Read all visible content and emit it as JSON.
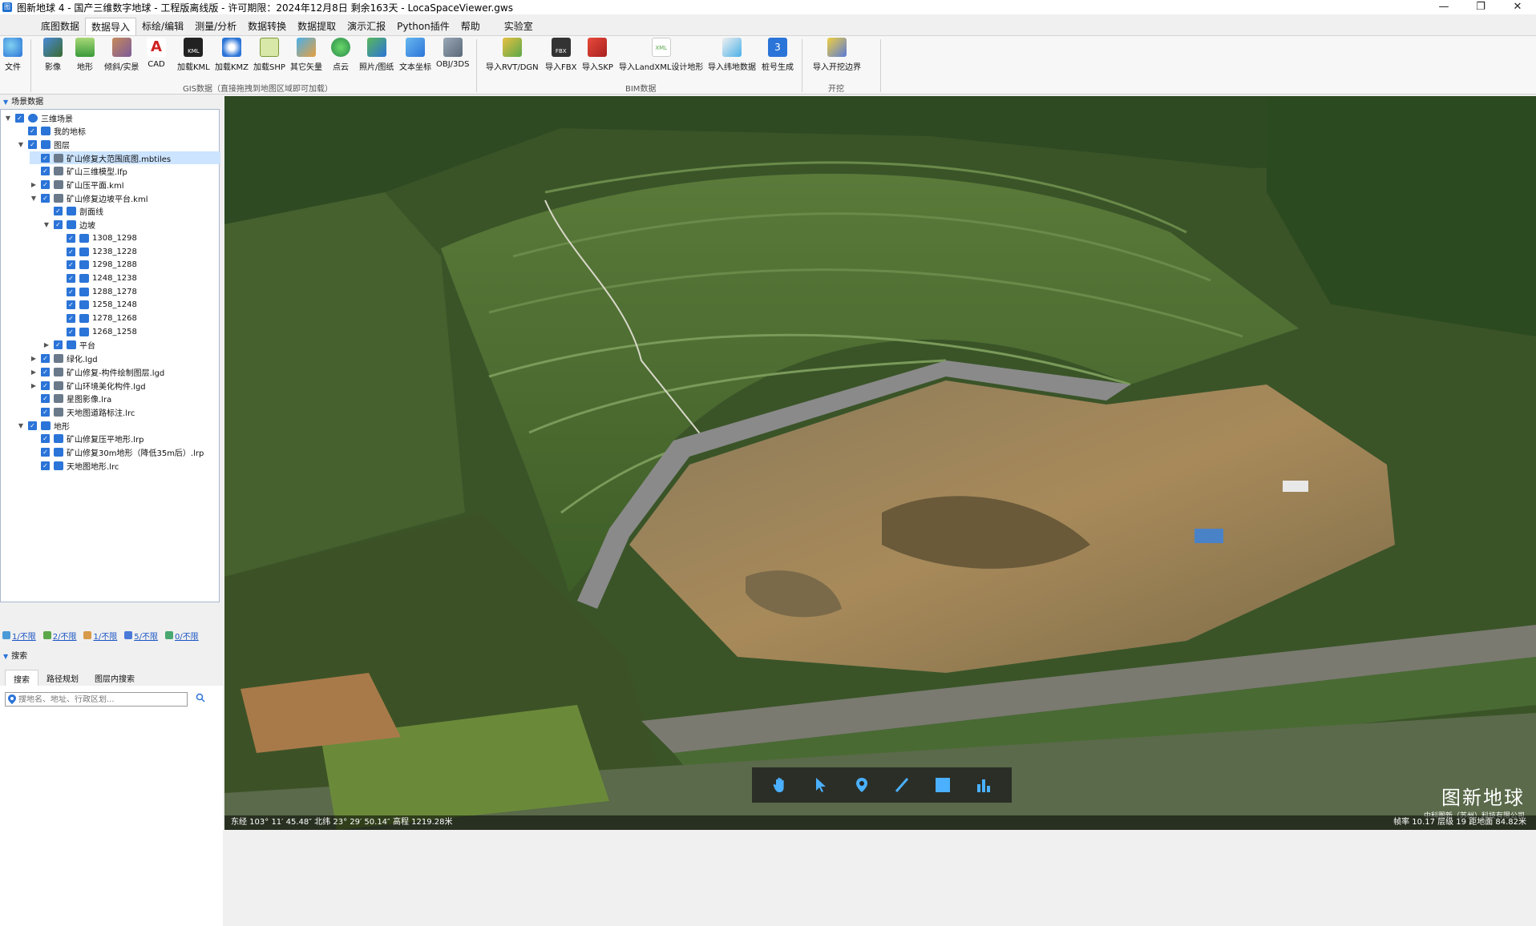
{
  "window": {
    "title": "图新地球 4 - 国产三维数字地球 - 工程版离线版 - 许可期限：2024年12月8日 剩余163天 - LocaSpaceViewer.gws",
    "minimize": "—",
    "maximize": "❐",
    "close": "✕"
  },
  "menu": [
    "底图数据",
    "数据导入",
    "标绘/编辑",
    "测量/分析",
    "数据转换",
    "数据提取",
    "演示汇报",
    "Python插件",
    "帮助",
    "实验室"
  ],
  "menu_active": "数据导入",
  "ribbon": {
    "file": "文件",
    "gis_buttons": [
      "影像",
      "地形",
      "倾斜/实景",
      "CAD",
      "加载KML",
      "加载KMZ",
      "加载SHP",
      "其它矢量",
      "点云",
      "照片/图纸",
      "文本坐标",
      "OBJ/3DS"
    ],
    "gis_group": "GIS数据（直接拖拽到地图区域即可加载）",
    "bim_buttons": [
      "导入RVT/DGN",
      "导入FBX",
      "导入SKP",
      "导入LandXML设计地形",
      "导入纬地数据",
      "桩号生成"
    ],
    "bim_group": "BIM数据",
    "excavation_buttons": [
      "导入开挖边界"
    ],
    "excavation_group": "开挖"
  },
  "scene_panel": {
    "title": "场景数据",
    "tree": [
      {
        "label": "三维场景",
        "level": 0,
        "arrow": "▼",
        "icon": "globe-icon"
      },
      {
        "label": "我的地标",
        "level": 1,
        "arrow": "",
        "icon": "pin-icon"
      },
      {
        "label": "图层",
        "level": 1,
        "arrow": "▼",
        "icon": "layers-icon"
      },
      {
        "label": "矿山修复大范围底图.mbtiles",
        "level": 2,
        "arrow": "",
        "icon": "tile-layer-icon",
        "selected": true
      },
      {
        "label": "矿山三维模型.lfp",
        "level": 2,
        "arrow": "",
        "icon": "model-icon"
      },
      {
        "label": "矿山压平面.kml",
        "level": 2,
        "arrow": "▶",
        "icon": "kml-icon"
      },
      {
        "label": "矿山修复边坡平台.kml",
        "level": 2,
        "arrow": "▼",
        "icon": "kml-icon"
      },
      {
        "label": "剖面线",
        "level": 3,
        "arrow": "",
        "icon": "folder-icon"
      },
      {
        "label": "边坡",
        "level": 3,
        "arrow": "▼",
        "icon": "folder-icon"
      },
      {
        "label": "1308_1298",
        "level": 4,
        "arrow": "",
        "icon": "polygon-icon"
      },
      {
        "label": "1238_1228",
        "level": 4,
        "arrow": "",
        "icon": "polygon-icon"
      },
      {
        "label": "1298_1288",
        "level": 4,
        "arrow": "",
        "icon": "polygon-icon"
      },
      {
        "label": "1248_1238",
        "level": 4,
        "arrow": "",
        "icon": "polygon-icon"
      },
      {
        "label": "1288_1278",
        "level": 4,
        "arrow": "",
        "icon": "polygon-icon"
      },
      {
        "label": "1258_1248",
        "level": 4,
        "arrow": "",
        "icon": "polygon-icon"
      },
      {
        "label": "1278_1268",
        "level": 4,
        "arrow": "",
        "icon": "polygon-icon"
      },
      {
        "label": "1268_1258",
        "level": 4,
        "arrow": "",
        "icon": "polygon-icon"
      },
      {
        "label": "平台",
        "level": 3,
        "arrow": "▶",
        "icon": "folder-icon"
      },
      {
        "label": "绿化.lgd",
        "level": 2,
        "arrow": "▶",
        "icon": "layer-file-icon"
      },
      {
        "label": "矿山修复-构件绘制图层.lgd",
        "level": 2,
        "arrow": "▶",
        "icon": "layer-file-icon"
      },
      {
        "label": "矿山环境美化构件.lgd",
        "level": 2,
        "arrow": "▶",
        "icon": "layer-file-icon"
      },
      {
        "label": "星图影像.lra",
        "level": 2,
        "arrow": "",
        "icon": "imagery-icon"
      },
      {
        "label": "天地图道路标注.lrc",
        "level": 2,
        "arrow": "",
        "icon": "imagery-icon"
      },
      {
        "label": "地形",
        "level": 1,
        "arrow": "▼",
        "icon": "terrain-icon"
      },
      {
        "label": "矿山修复压平地形.lrp",
        "level": 2,
        "arrow": "",
        "icon": "terrain-file-icon"
      },
      {
        "label": "矿山修复30m地形（降低35m后）.lrp",
        "level": 2,
        "arrow": "",
        "icon": "terrain-file-icon"
      },
      {
        "label": "天地图地形.lrc",
        "level": 2,
        "arrow": "",
        "icon": "terrain-file-icon"
      }
    ],
    "stats": [
      {
        "label": "1/不限",
        "color": "#4a9ad8"
      },
      {
        "label": "2/不限",
        "color": "#5aa84a"
      },
      {
        "label": "1/不限",
        "color": "#d89a4a"
      },
      {
        "label": "5/不限",
        "color": "#4a7ad8"
      },
      {
        "label": "0/不限",
        "color": "#48a870"
      }
    ]
  },
  "search_panel": {
    "title": "搜索",
    "tabs": [
      "搜索",
      "路径规划",
      "图层内搜索"
    ],
    "placeholder": "搜地名、地址、行政区划..."
  },
  "viewport": {
    "toolbar": [
      "pan-hand-icon",
      "select-arrow-icon",
      "place-pin-icon",
      "draw-line-icon",
      "draw-rect-icon",
      "chart-icon"
    ],
    "watermark_title": "图新地球",
    "watermark_sub": "中科图新（苏州）科技有限公司",
    "status_coords": "东经 103° 11′ 45.48″  北纬 23° 29′ 50.14″  高程 1219.28米",
    "status_right": "帧率 10.17  层级 19  距地面 84.82米"
  },
  "colors": {
    "accent": "#2b74d8",
    "selection": "#cce4ff"
  }
}
